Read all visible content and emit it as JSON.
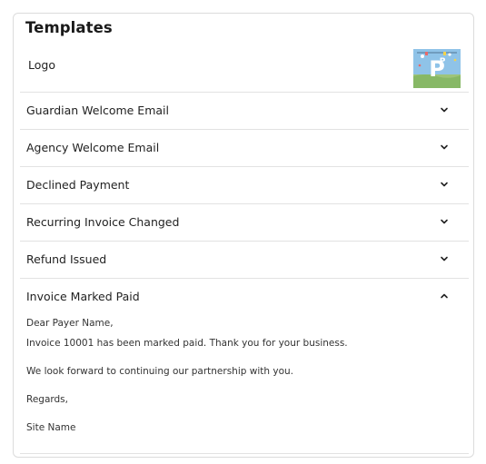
{
  "card": {
    "title": "Templates",
    "logo_label": "Logo"
  },
  "icons": {
    "collapsed": "chevron-down-icon",
    "expanded": "chevron-up-icon"
  },
  "templates": [
    {
      "label": "Guardian Welcome Email",
      "expanded": false
    },
    {
      "label": "Agency Welcome Email",
      "expanded": false
    },
    {
      "label": "Declined Payment",
      "expanded": false
    },
    {
      "label": "Recurring Invoice Changed",
      "expanded": false
    },
    {
      "label": "Refund Issued",
      "expanded": false
    },
    {
      "label": "Invoice Marked Paid",
      "expanded": true
    }
  ],
  "expanded_body": {
    "greeting": "Dear Payer Name,",
    "line1": "Invoice 10001 has been marked paid. Thank you for your business.",
    "line2": "We look forward to continuing our partnership with you.",
    "closing": "Regards,",
    "signature": "Site Name"
  },
  "colors": {
    "border": "#dcdcdc",
    "divider": "#e2e2e2",
    "text": "#222222",
    "logo_sky": "#8fc3e8",
    "logo_grass": "#9ec47a"
  }
}
